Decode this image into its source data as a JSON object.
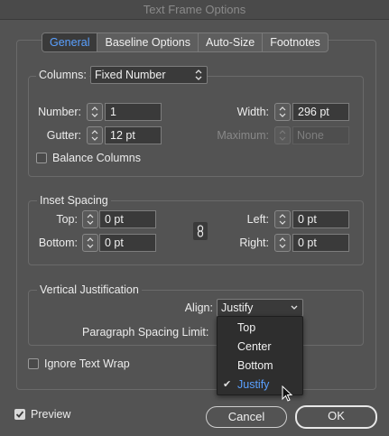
{
  "window": {
    "title": "Text Frame Options"
  },
  "tabs": [
    "General",
    "Baseline Options",
    "Auto-Size",
    "Footnotes"
  ],
  "active_tab": "General",
  "columns": {
    "label": "Columns:",
    "type_value": "Fixed Number",
    "number_label": "Number:",
    "number_value": "1",
    "gutter_label": "Gutter:",
    "gutter_value": "12 pt",
    "width_label": "Width:",
    "width_value": "296 pt",
    "maximum_label": "Maximum:",
    "maximum_value": "None",
    "balance_label": "Balance Columns",
    "balance_checked": false
  },
  "inset": {
    "title": "Inset Spacing",
    "top_label": "Top:",
    "top_value": "0 pt",
    "bottom_label": "Bottom:",
    "bottom_value": "0 pt",
    "left_label": "Left:",
    "left_value": "0 pt",
    "right_label": "Right:",
    "right_value": "0 pt"
  },
  "vertical": {
    "title": "Vertical Justification",
    "align_label": "Align:",
    "align_value": "Justify",
    "spacing_label": "Paragraph Spacing Limit:",
    "options": [
      "Top",
      "Center",
      "Bottom",
      "Justify"
    ],
    "selected_option": "Justify"
  },
  "ignore_wrap": {
    "label": "Ignore Text Wrap",
    "checked": false
  },
  "preview": {
    "label": "Preview",
    "checked": true
  },
  "buttons": {
    "cancel": "Cancel",
    "ok": "OK"
  },
  "colors": {
    "accent": "#5aa0ff",
    "background": "#535353",
    "field": "#3a3a3a"
  }
}
